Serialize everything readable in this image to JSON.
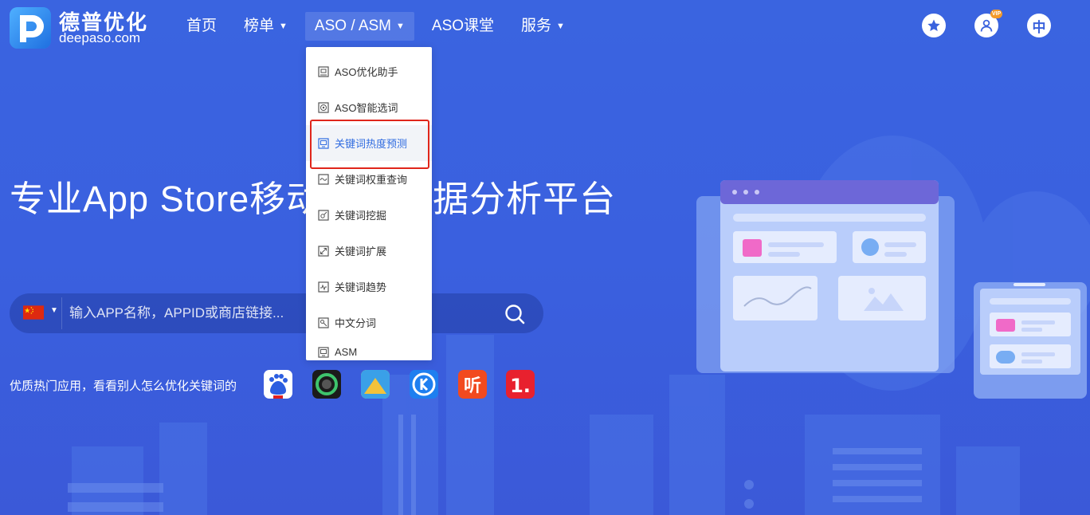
{
  "brand": {
    "name_cn": "德普优化",
    "name_en": "deepaso.com"
  },
  "nav": [
    {
      "label": "首页",
      "has_caret": false,
      "active": false
    },
    {
      "label": "榜单",
      "has_caret": true,
      "active": false
    },
    {
      "label": "ASO / ASM",
      "has_caret": true,
      "active": true
    },
    {
      "label": "ASO课堂",
      "has_caret": false,
      "active": false
    },
    {
      "label": "服务",
      "has_caret": true,
      "active": false
    }
  ],
  "header_icons": {
    "favorite": "star-icon",
    "user": "user-icon",
    "vip_badge": "VIP",
    "language": "中"
  },
  "dropdown": {
    "items": [
      {
        "label": "ASO优化助手",
        "icon": "robot-icon"
      },
      {
        "label": "ASO智能选词",
        "icon": "target-icon"
      },
      {
        "label": "关键词热度预测",
        "icon": "monitor-icon",
        "highlighted": true
      },
      {
        "label": "关键词权重查询",
        "icon": "chain-icon"
      },
      {
        "label": "关键词挖掘",
        "icon": "shovel-icon"
      },
      {
        "label": "关键词扩展",
        "icon": "expand-icon"
      },
      {
        "label": "关键词趋势",
        "icon": "trend-icon"
      },
      {
        "label": "中文分词",
        "icon": "split-icon"
      },
      {
        "label": "ASM",
        "icon": "screen-icon"
      }
    ]
  },
  "hero": {
    "title": "专业App Store移动应用数据分析平台"
  },
  "search": {
    "country": "china-flag",
    "placeholder": "输入APP名称，APPID或商店链接..."
  },
  "hot_apps": {
    "label": "优质热门应用，看看别人怎么优化关键词的",
    "apps": [
      "baidu-app-icon",
      "camera-app-icon",
      "game-app-icon",
      "browser-app-icon",
      "ting-app-icon",
      "one-app-icon"
    ]
  },
  "colors": {
    "background": "#3a62dd",
    "accent": "#2f6be0",
    "highlight_border": "#e0261b",
    "vip": "#f39a2b"
  }
}
